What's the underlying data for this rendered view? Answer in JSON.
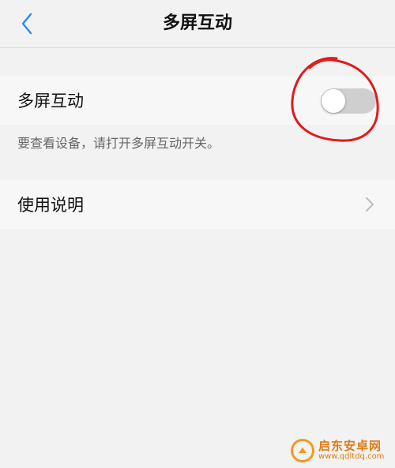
{
  "header": {
    "title": "多屏互动",
    "back_icon": "chevron-left-icon",
    "accent_color": "#2d8cf0"
  },
  "multi_screen": {
    "label": "多屏互动",
    "toggle_state": "off",
    "hint": "要查看设备，请打开多屏互动开关。"
  },
  "instructions": {
    "label": "使用说明",
    "chevron_icon": "chevron-right-icon"
  },
  "annotation": {
    "shape": "hand-drawn-circle",
    "color": "#e01b1b"
  },
  "watermark": {
    "name": "启东安卓网",
    "url": "www.qdltdq.com",
    "color": "#e07b12"
  }
}
